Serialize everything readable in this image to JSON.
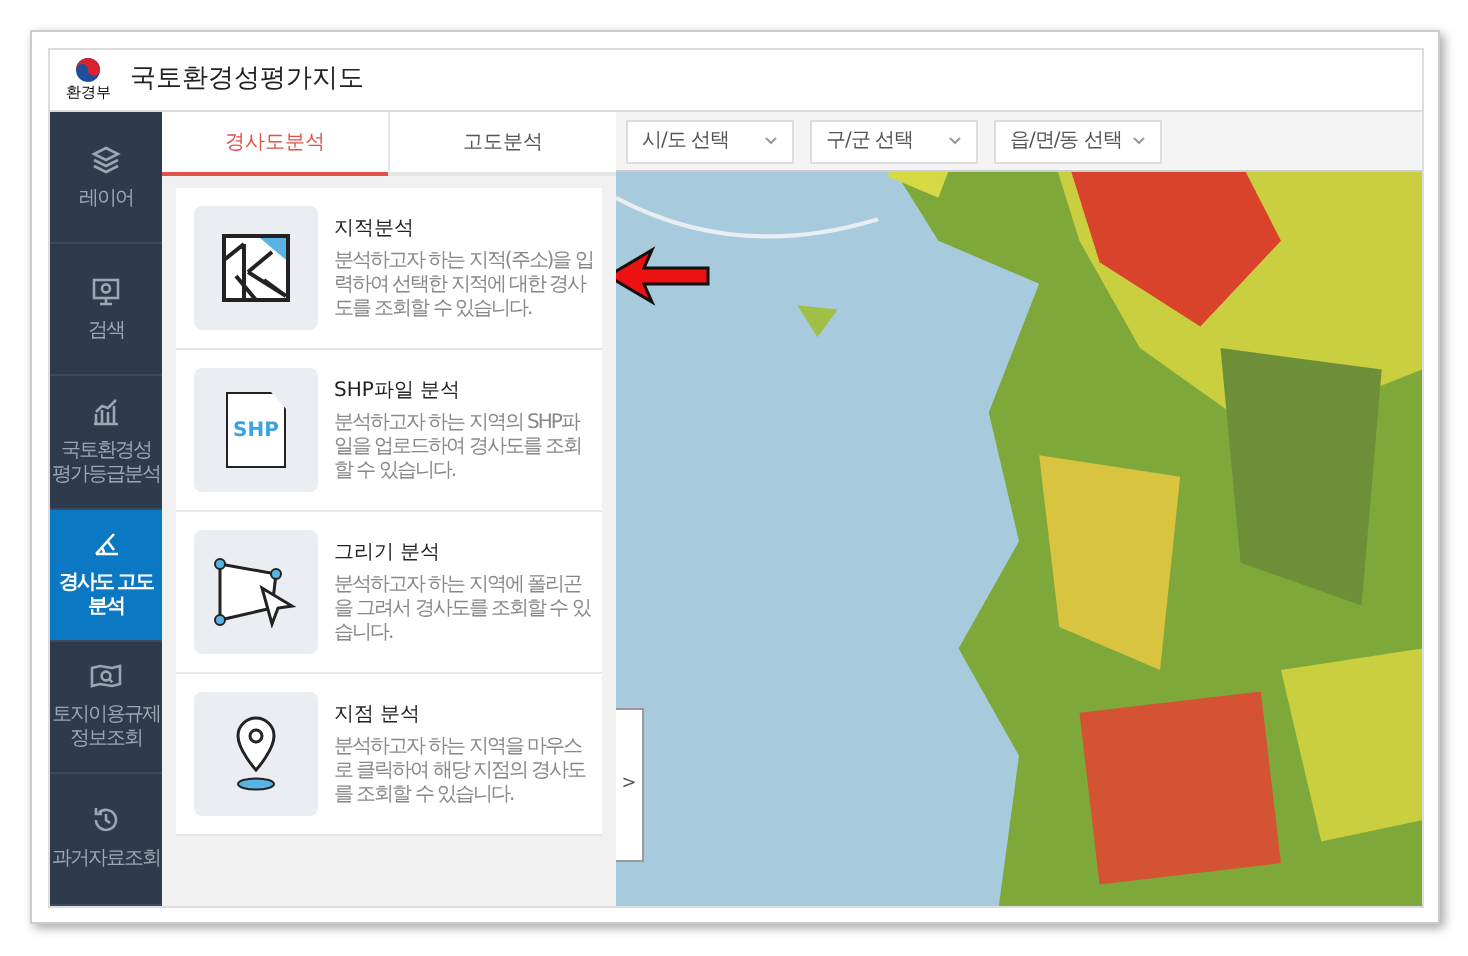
{
  "header": {
    "title": "국토환경성평가지도",
    "logo_caption": "환경부"
  },
  "sidebar": {
    "items": [
      {
        "label": "레이어",
        "kind": "layers",
        "selected": false
      },
      {
        "label": "검색",
        "kind": "search",
        "selected": false
      },
      {
        "label": "국토환경성 평가등급분석",
        "kind": "chart",
        "selected": false
      },
      {
        "label": "경사도 고도 분석",
        "kind": "slope",
        "selected": true
      },
      {
        "label": "토지이용규제 정보조회",
        "kind": "map",
        "selected": false
      },
      {
        "label": "과거자료조회",
        "kind": "history",
        "selected": false
      }
    ]
  },
  "tabs": [
    {
      "label": "경사도분석",
      "selected": true
    },
    {
      "label": "고도분석",
      "selected": false
    }
  ],
  "cards": [
    {
      "kind": "cadastral",
      "title": "지적분석",
      "description": "분석하고자 하는 지적(주소)을 입력하여 선택한 지적에 대한 경사도를 조회할 수 있습니다."
    },
    {
      "kind": "shp",
      "title": "SHP파일 분석",
      "description": "분석하고자 하는 지역의 SHP파일을 업로드하여 경사도를 조회 할 수 있습니다.",
      "icon_text": "SHP"
    },
    {
      "kind": "draw",
      "title": "그리기 분석",
      "description": "분석하고자 하는 지역에 폴리곤을 그려서 경사도를 조회할 수 있습니다."
    },
    {
      "kind": "point",
      "title": "지점 분석",
      "description": "분석하고자 하는 지역을 마우스로 클릭하여 해당 지점의 경사도를 조회할 수 있습니다."
    }
  ],
  "selects": [
    {
      "placeholder": "시/도 선택"
    },
    {
      "placeholder": "구/군 선택"
    },
    {
      "placeholder": "읍/면/동 선택"
    }
  ],
  "collapse_handle": {
    "label": ">"
  }
}
